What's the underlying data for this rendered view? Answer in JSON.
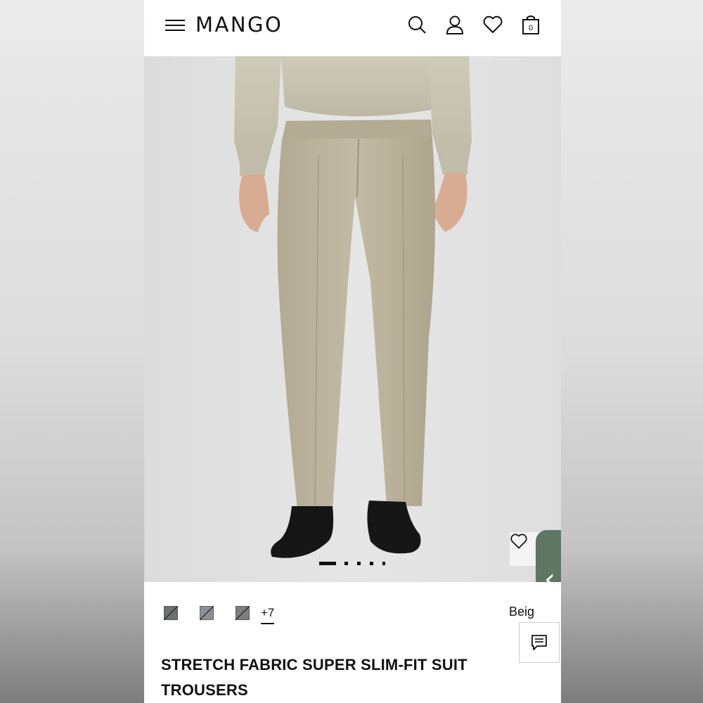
{
  "header": {
    "logo": "MANGO",
    "icons": [
      "menu-icon",
      "search-icon",
      "user-icon",
      "heart-icon",
      "bag-icon"
    ],
    "bag_count": "0"
  },
  "gallery": {
    "active_index": 1,
    "total_images": 5
  },
  "product": {
    "colors_more": "+7",
    "color_label": "Beig",
    "title": "STRETCH FABRIC SUPER SLIM-FIT SUIT TROUSERS"
  },
  "colors": {
    "tab_green": "#5f7664",
    "trouser_beige": "#bbb29d",
    "swatch_grey": "#8a8f98"
  }
}
